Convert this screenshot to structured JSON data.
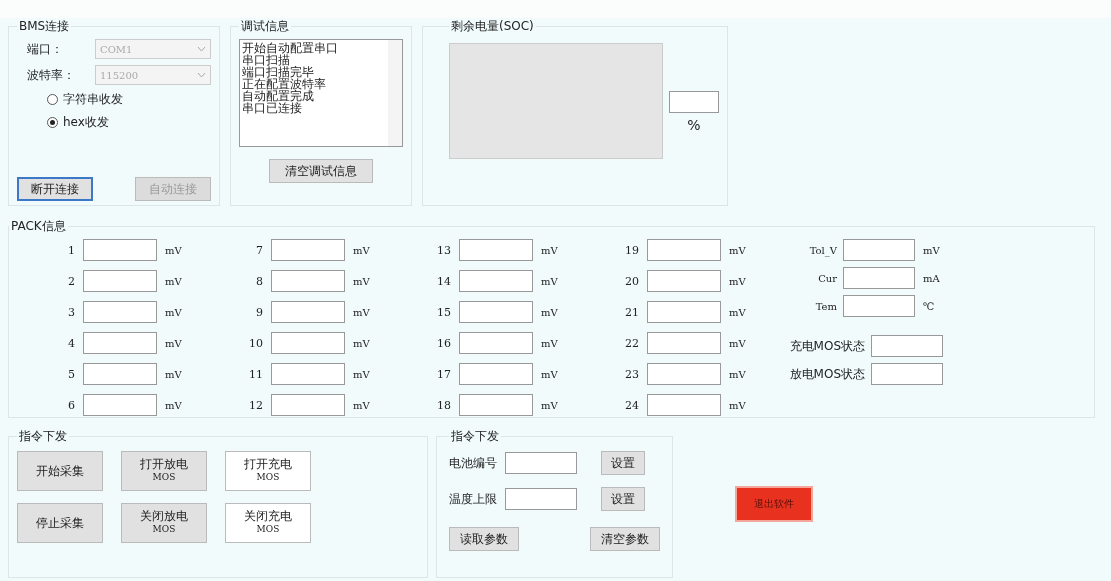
{
  "bms": {
    "title": "BMS连接",
    "port_label": "端口：",
    "port_value": "COM1",
    "baud_label": "波特率：",
    "baud_value": "115200",
    "modes": [
      {
        "label": "字符串收发",
        "selected": false
      },
      {
        "label": "hex收发",
        "selected": true
      }
    ],
    "buttons": [
      {
        "label": "断开连接",
        "disabled": false,
        "focused": true
      },
      {
        "label": "自动连接",
        "disabled": true,
        "focused": false
      }
    ]
  },
  "debug": {
    "title": "调试信息",
    "lines": [
      "开始自动配置串口",
      "串口扫描",
      "端口扫描完毕",
      "正在配置波特率",
      "自动配置完成",
      "串口已连接"
    ],
    "button": "清空调试信息"
  },
  "soc": {
    "title": "剩余电量(SOC)",
    "unit": "%"
  },
  "pack": {
    "title": "PACK信息",
    "cells": [
      {
        "label": "1",
        "unit": "mV"
      },
      {
        "label": "2",
        "unit": "mV"
      },
      {
        "label": "3",
        "unit": "mV"
      },
      {
        "label": "4",
        "unit": "mV"
      },
      {
        "label": "5",
        "unit": "mV"
      },
      {
        "label": "6",
        "unit": "mV"
      },
      {
        "label": "7",
        "unit": "mV"
      },
      {
        "label": "8",
        "unit": "mV"
      },
      {
        "label": "9",
        "unit": "mV"
      },
      {
        "label": "10",
        "unit": "mV"
      },
      {
        "label": "11",
        "unit": "mV"
      },
      {
        "label": "12",
        "unit": "mV"
      },
      {
        "label": "13",
        "unit": "mV"
      },
      {
        "label": "14",
        "unit": "mV"
      },
      {
        "label": "15",
        "unit": "mV"
      },
      {
        "label": "16",
        "unit": "mV"
      },
      {
        "label": "17",
        "unit": "mV"
      },
      {
        "label": "18",
        "unit": "mV"
      },
      {
        "label": "19",
        "unit": "mV"
      },
      {
        "label": "20",
        "unit": "mV"
      },
      {
        "label": "21",
        "unit": "mV"
      },
      {
        "label": "22",
        "unit": "mV"
      },
      {
        "label": "23",
        "unit": "mV"
      },
      {
        "label": "24",
        "unit": "mV"
      }
    ],
    "summary": [
      {
        "label": "Tol_V",
        "unit": "mV"
      },
      {
        "label": "Cur",
        "unit": "mA"
      },
      {
        "label": "Tem",
        "unit": "℃"
      }
    ],
    "states": [
      {
        "label": "充电MOS状态"
      },
      {
        "label": "放电MOS状态"
      }
    ]
  },
  "commands": {
    "title": "指令下发",
    "buttons": [
      {
        "label": "开始采集",
        "kind": "gray"
      },
      {
        "label": "打开放电",
        "sublabel": "MOS",
        "kind": "gray"
      },
      {
        "label": "打开充电",
        "sublabel": "MOS",
        "kind": "light"
      },
      {
        "label": "停止采集",
        "kind": "gray"
      },
      {
        "label": "关闭放电",
        "sublabel": "MOS",
        "kind": "gray"
      },
      {
        "label": "关闭充电",
        "sublabel": "MOS",
        "kind": "light"
      }
    ]
  },
  "params": {
    "title": "指令下发",
    "rows": [
      {
        "label": "电池编号",
        "button": "设置"
      },
      {
        "label": "温度上限",
        "button": "设置"
      }
    ],
    "buttons": [
      "读取参数",
      "清空参数"
    ]
  },
  "exit_button": "退出软件"
}
